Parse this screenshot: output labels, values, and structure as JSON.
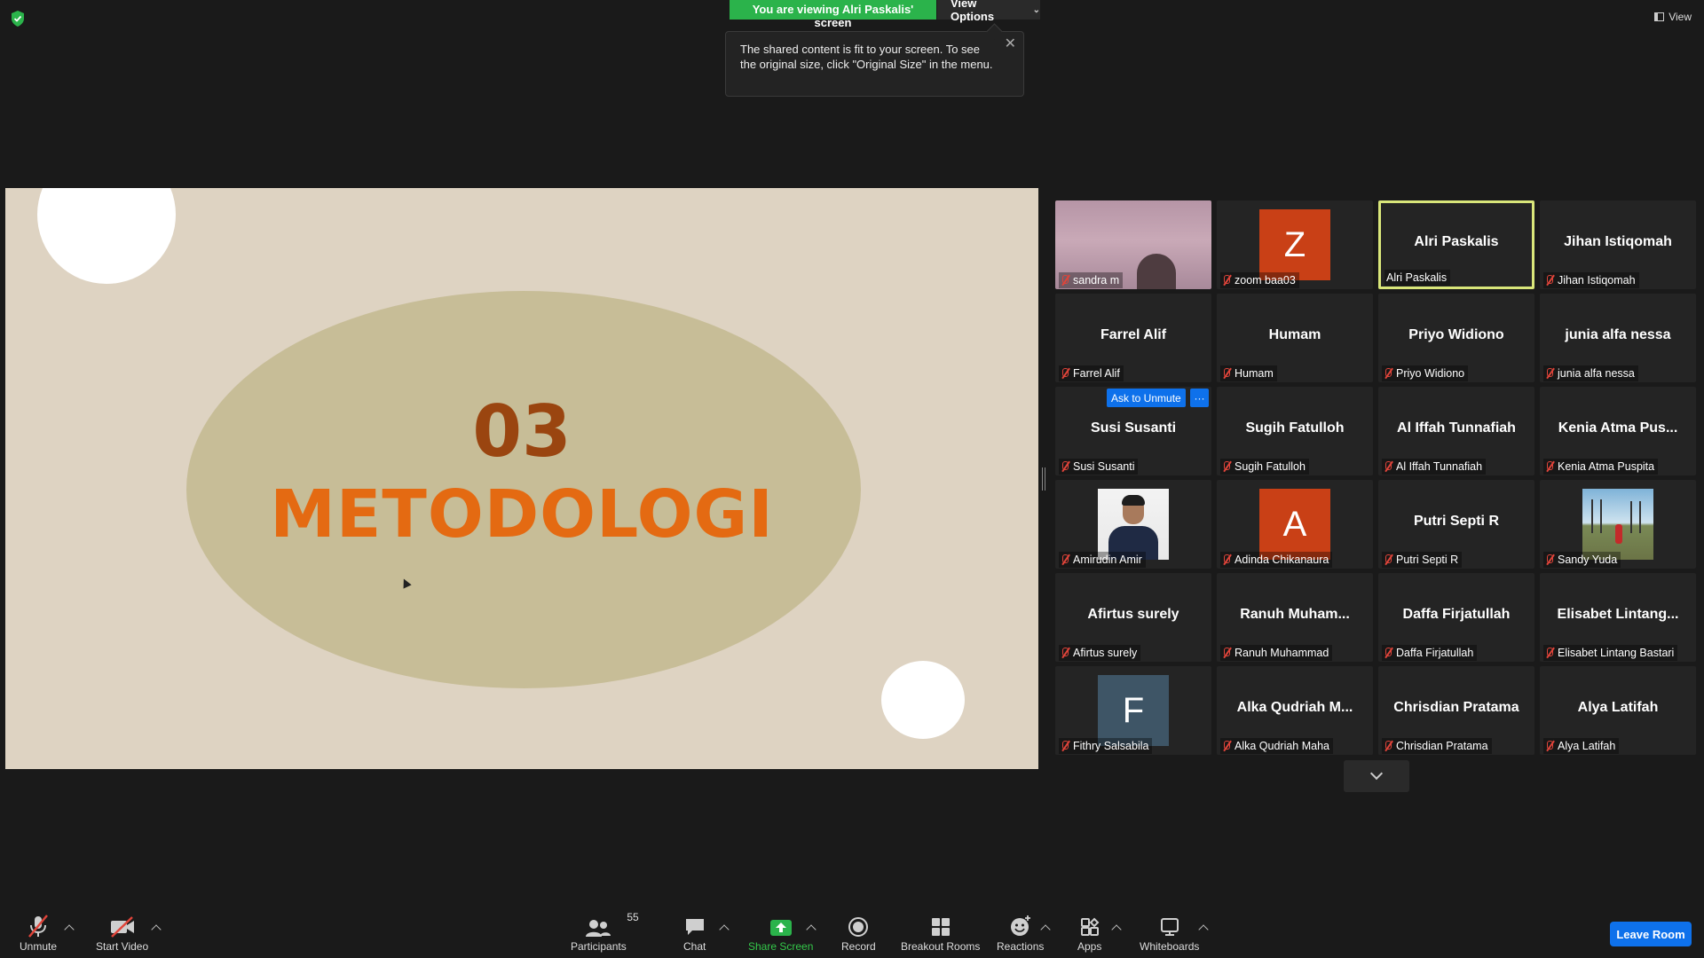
{
  "banner": {
    "viewing": "You are viewing Alri Paskalis' screen",
    "view_options": "View Options",
    "view_top_right": "View"
  },
  "tooltip": {
    "text": "The shared content is fit to your screen. To see the original size, click \"Original Size\" in the menu."
  },
  "slide": {
    "number": "03",
    "title": "METODOLOGI"
  },
  "gallery": {
    "ask_unmute": "Ask to Unmute",
    "more": "···",
    "tiles": [
      {
        "center": "",
        "label": "sandra m"
      },
      {
        "center": "",
        "avatar": "Z",
        "label": "zoom baa03"
      },
      {
        "center": "Alri Paskalis",
        "label": "Alri Paskalis"
      },
      {
        "center": "Jihan Istiqomah",
        "label": "Jihan Istiqomah"
      },
      {
        "center": "Farrel Alif",
        "label": "Farrel Alif"
      },
      {
        "center": "Humam",
        "label": "Humam"
      },
      {
        "center": "Priyo Widiono",
        "label": "Priyo Widiono"
      },
      {
        "center": "junia alfa nessa",
        "label": "junia alfa nessa"
      },
      {
        "center": "Susi Susanti",
        "label": "Susi Susanti"
      },
      {
        "center": "Sugih Fatulloh",
        "label": "Sugih Fatulloh"
      },
      {
        "center": "Al Iffah Tunnafiah",
        "label": "Al Iffah Tunnafiah"
      },
      {
        "center": "Kenia Atma Pus...",
        "label": "Kenia Atma Puspita"
      },
      {
        "center": "",
        "label": "Amirudin Amir"
      },
      {
        "center": "",
        "avatar": "A",
        "label": "Adinda Chikanaura"
      },
      {
        "center": "Putri Septi R",
        "label": "Putri Septi R"
      },
      {
        "center": "",
        "label": "Sandy Yuda"
      },
      {
        "center": "Afirtus surely",
        "label": "Afirtus surely"
      },
      {
        "center": "Ranuh  Muham...",
        "label": "Ranuh Muhammad"
      },
      {
        "center": "Daffa Firjatullah",
        "label": "Daffa Firjatullah"
      },
      {
        "center": "Elisabet  Lintang...",
        "label": "Elisabet Lintang Bastari"
      },
      {
        "center": "",
        "avatar": "F",
        "label": "Fithry Salsabila"
      },
      {
        "center": "Alka  Qudriah  M...",
        "label": "Alka Qudriah Maha"
      },
      {
        "center": "Chrisdian Pratama",
        "label": "Chrisdian Pratama"
      },
      {
        "center": "Alya Latifah",
        "label": "Alya Latifah"
      }
    ]
  },
  "toolbar": {
    "unmute": "Unmute",
    "start_video": "Start Video",
    "participants": "Participants",
    "participant_count": "55",
    "chat": "Chat",
    "share_screen": "Share Screen",
    "record": "Record",
    "breakout_rooms": "Breakout Rooms",
    "reactions": "Reactions",
    "apps": "Apps",
    "whiteboards": "Whiteboards",
    "leave": "Leave Room"
  },
  "colors": {
    "share_green": "#2bb34b",
    "accent_blue": "#0e71eb",
    "muted_red": "#e0443a",
    "active_speaker": "#d9e67a",
    "slide_bg": "#ded3c2",
    "slide_title": "#e46a12",
    "slide_number": "#9a4510"
  }
}
